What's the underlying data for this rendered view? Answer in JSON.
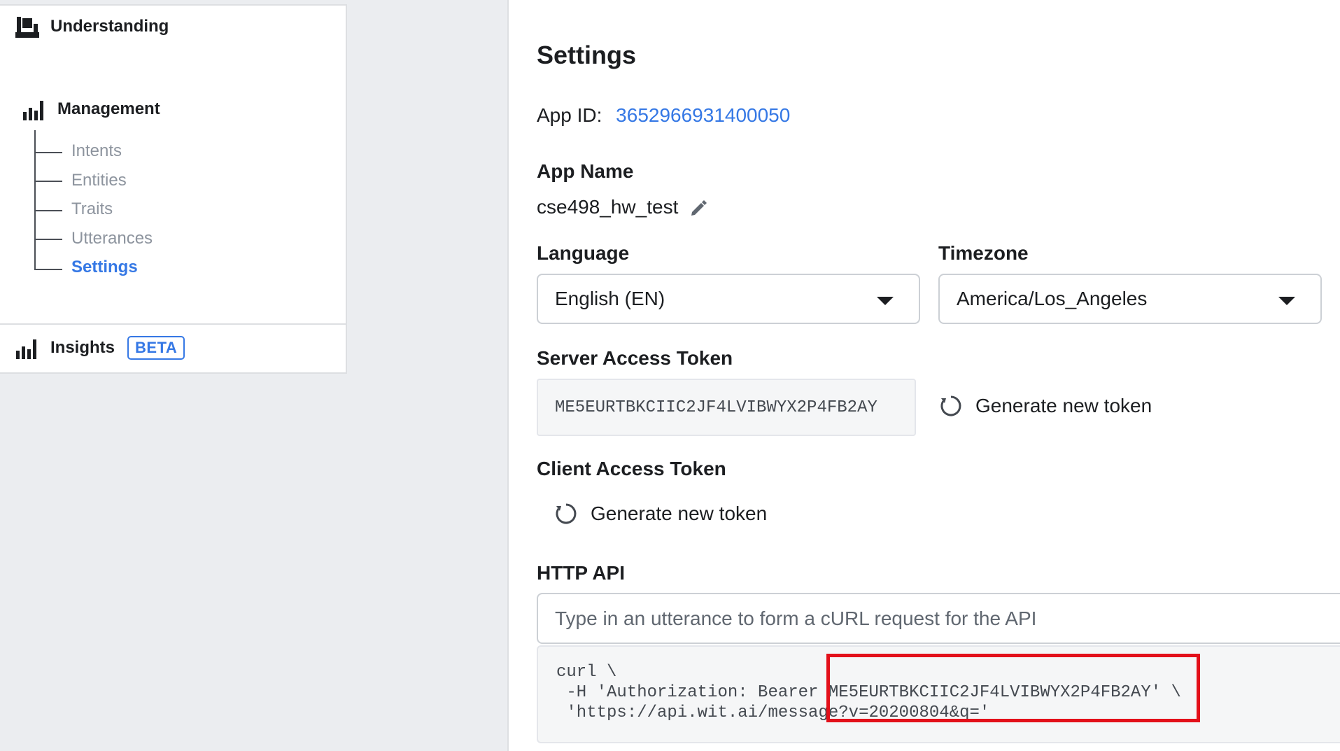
{
  "sidebar": {
    "understanding_label": "Understanding",
    "management_label": "Management",
    "items": [
      {
        "label": "Intents"
      },
      {
        "label": "Entities"
      },
      {
        "label": "Traits"
      },
      {
        "label": "Utterances"
      },
      {
        "label": "Settings",
        "active": true
      }
    ],
    "insights_label": "Insights",
    "insights_badge": "BETA"
  },
  "settings": {
    "title": "Settings",
    "app_id_label": "App ID:",
    "app_id_value": "3652966931400050",
    "app_name_label": "App Name",
    "app_name_value": "cse498_hw_test",
    "language_label": "Language",
    "language_value": "English (EN)",
    "timezone_label": "Timezone",
    "timezone_value": "America/Los_Angeles",
    "server_token_label": "Server Access Token",
    "server_token_value": "ME5EURTBKCIIC2JF4LVIBWYX2P4FB2AY",
    "generate_label": "Generate new token",
    "client_token_label": "Client Access Token",
    "client_generate_label": "Generate new token",
    "http_api_label": "HTTP API",
    "http_api_placeholder": "Type in an utterance to form a cURL request for the API",
    "curl_lines": [
      "curl \\",
      " -H 'Authorization: Bearer ME5EURTBKCIIC2JF4LVIBWYX2P4FB2AY' \\",
      " 'https://api.wit.ai/message?v=20200804&q='"
    ]
  },
  "colors": {
    "accent": "#3578e5",
    "highlight": "#e3101a",
    "background": "#ebedf0"
  }
}
